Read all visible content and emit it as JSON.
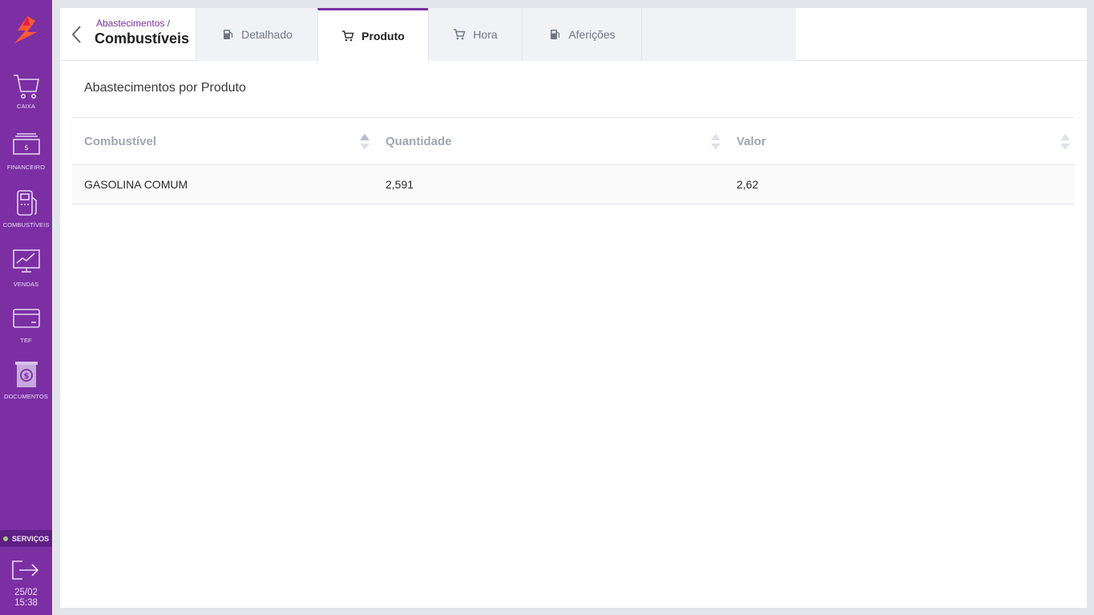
{
  "sidebar": {
    "items": [
      {
        "label": "CAIXA",
        "icon": "cart-icon"
      },
      {
        "label": "FINANCEIRO",
        "icon": "money-icon"
      },
      {
        "label": "COMBUSTÍVEIS",
        "icon": "fuel-pump-icon"
      },
      {
        "label": "VENDAS",
        "icon": "monitor-chart-icon"
      },
      {
        "label": "TEF",
        "icon": "card-icon"
      },
      {
        "label": "DOCUMENTOS",
        "icon": "document-dollar-icon"
      }
    ],
    "services_label": "SERVIÇOS",
    "date": "25/02",
    "time": "15:38"
  },
  "header": {
    "breadcrumb": "Abastecimentos",
    "breadcrumb_sep": "/",
    "title": "Combustíveis"
  },
  "tabs": [
    {
      "label": "Detalhado",
      "icon": "fuel-pump-icon",
      "active": false
    },
    {
      "label": "Produto",
      "icon": "cart-icon",
      "active": true
    },
    {
      "label": "Hora",
      "icon": "cart-icon",
      "active": false
    },
    {
      "label": "Aferições",
      "icon": "fuel-pump-icon",
      "active": false
    }
  ],
  "section": {
    "title": "Abastecimentos por Produto"
  },
  "table": {
    "columns": [
      "Combustível",
      "Quantidade",
      "Valor"
    ],
    "rows": [
      [
        "GASOLINA COMUM",
        "2,591",
        "2,62"
      ]
    ]
  },
  "colors": {
    "sidebar": "#7b2fa3",
    "accent": "#7b2fa3",
    "tab_inactive": "#f1f2f6"
  }
}
